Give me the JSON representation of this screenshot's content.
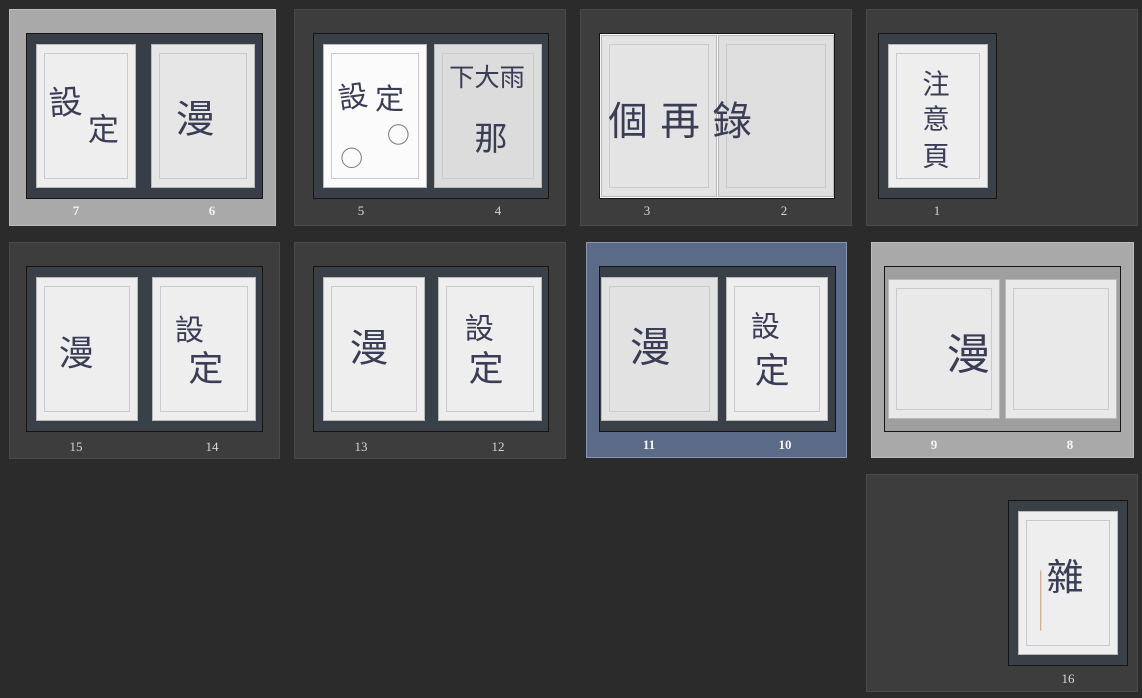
{
  "spreads": [
    {
      "id": "7-6",
      "pages": [
        {
          "num": "7",
          "mark": "設定"
        },
        {
          "num": "6",
          "mark": "漫"
        }
      ],
      "selected": "grey"
    },
    {
      "id": "5-4",
      "pages": [
        {
          "num": "5",
          "mark": "設定"
        },
        {
          "num": "4",
          "mark": "下大雨 那"
        }
      ],
      "selected": "none"
    },
    {
      "id": "3-2",
      "pages": [
        {
          "num": "3",
          "mark": ""
        },
        {
          "num": "2",
          "mark": ""
        }
      ],
      "mark": "個 再 錄",
      "selected": "none"
    },
    {
      "id": "1",
      "pages": [
        {
          "num": "1",
          "mark": "注意頁"
        }
      ],
      "selected": "none"
    },
    {
      "id": "15-14",
      "pages": [
        {
          "num": "15",
          "mark": "漫"
        },
        {
          "num": "14",
          "mark": "設定"
        }
      ],
      "selected": "none"
    },
    {
      "id": "13-12",
      "pages": [
        {
          "num": "13",
          "mark": "漫"
        },
        {
          "num": "12",
          "mark": "設定"
        }
      ],
      "selected": "none"
    },
    {
      "id": "11-10",
      "pages": [
        {
          "num": "11",
          "mark": "漫"
        },
        {
          "num": "10",
          "mark": "設定"
        }
      ],
      "selected": "blue"
    },
    {
      "id": "9-8",
      "pages": [
        {
          "num": "9",
          "mark": ""
        },
        {
          "num": "8",
          "mark": ""
        }
      ],
      "mark": "漫",
      "selected": "grey"
    },
    {
      "id": "16",
      "pages": [
        {
          "num": "16",
          "mark": "雜"
        }
      ],
      "selected": "none"
    }
  ]
}
